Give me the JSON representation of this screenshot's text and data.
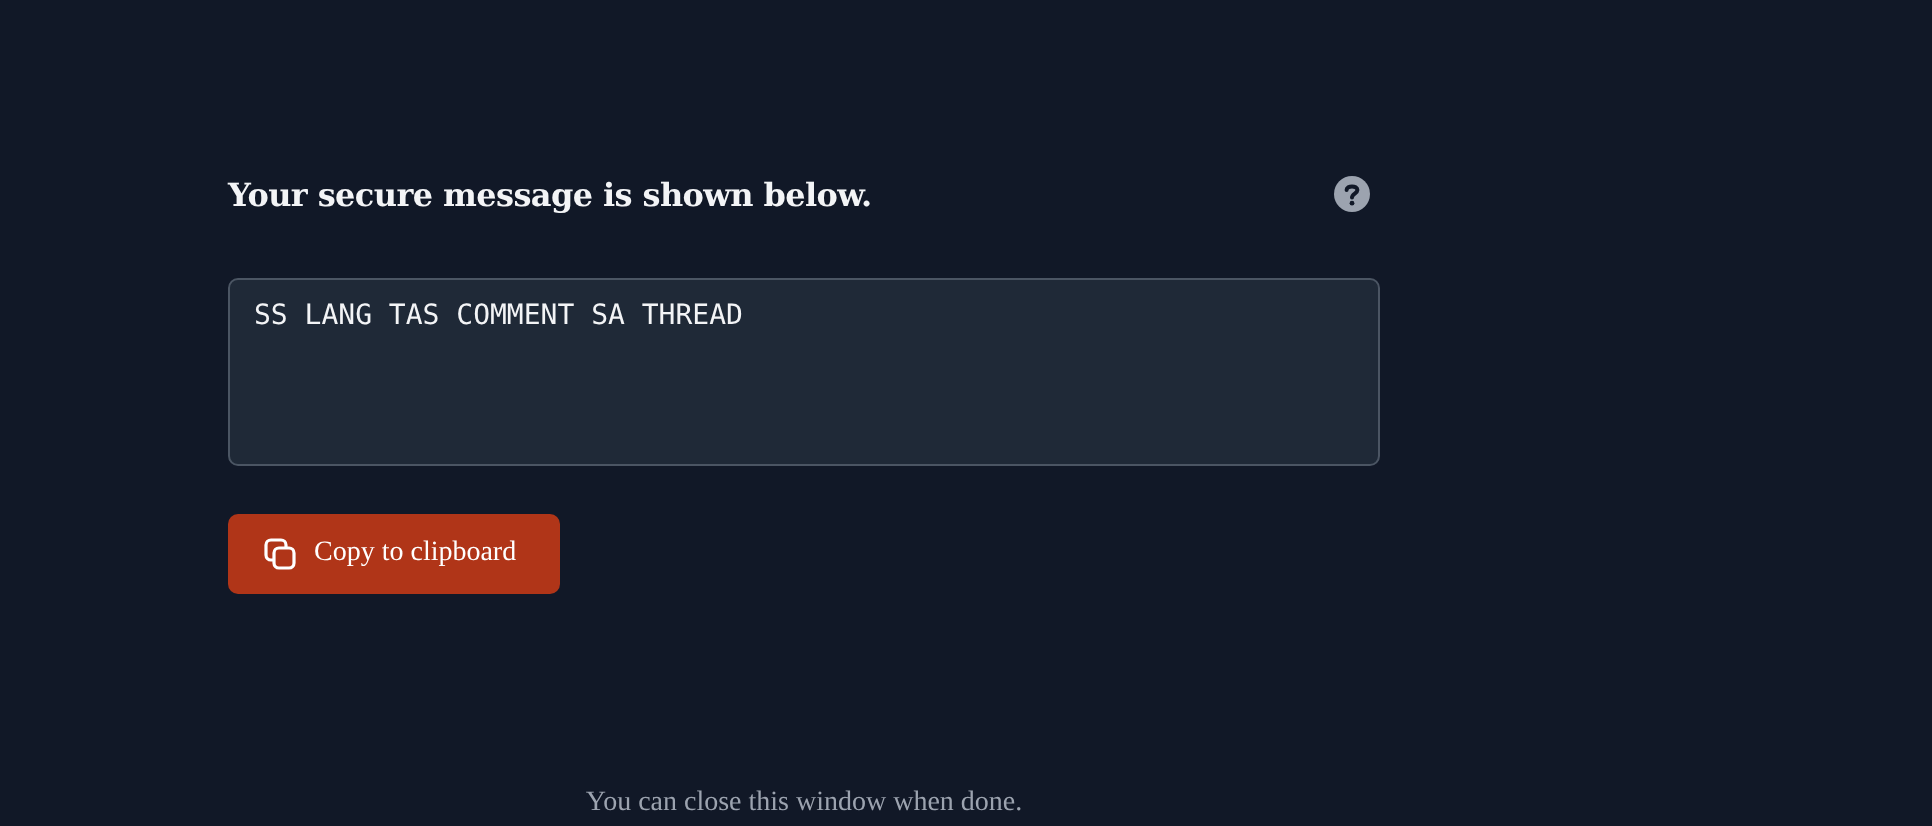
{
  "heading": "Your secure message is shown below.",
  "message": {
    "value": "SS LANG TAS COMMENT SA THREAD"
  },
  "copy_button": {
    "label": "Copy to clipboard"
  },
  "footer": "You can close this window when done."
}
